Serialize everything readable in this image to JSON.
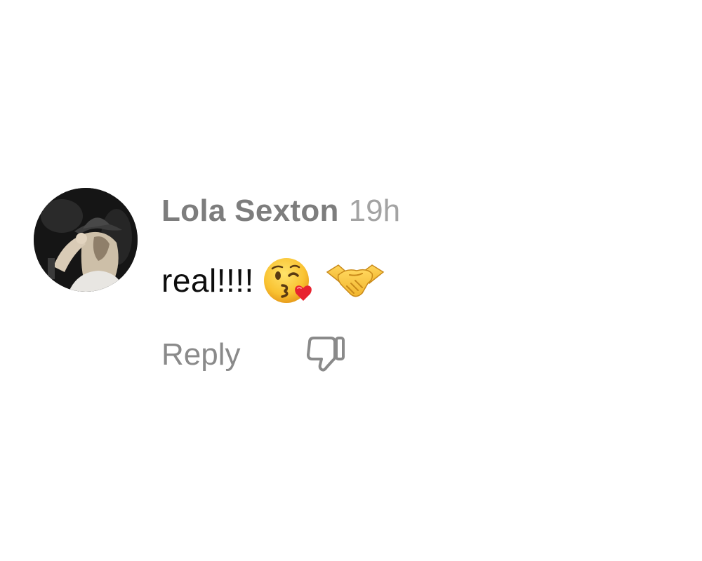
{
  "comment": {
    "username": "Lola Sexton",
    "timestamp": "19h",
    "text": "real!!!!",
    "emojis": [
      {
        "name": "face-blowing-a-kiss-icon"
      },
      {
        "name": "handshake-icon"
      }
    ],
    "reply_label": "Reply",
    "dislike_icon": "thumbs-down-icon"
  }
}
